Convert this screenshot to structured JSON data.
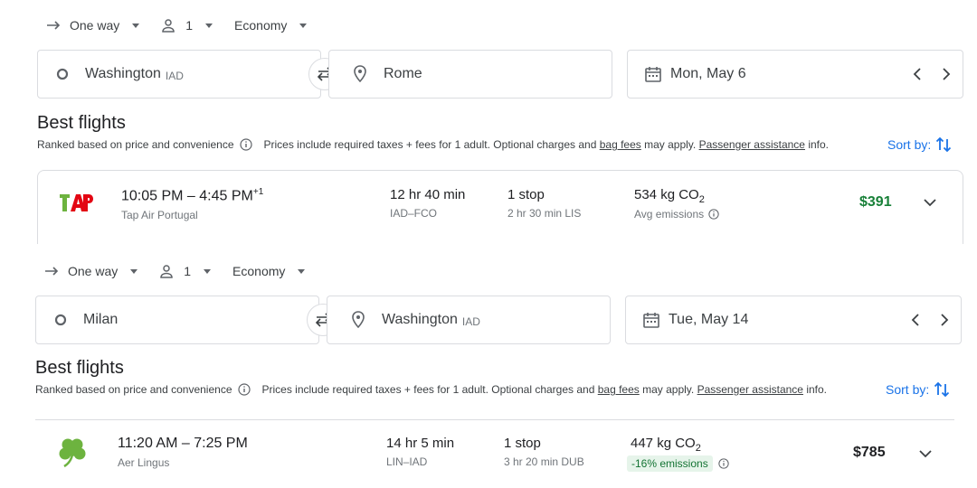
{
  "searches": [
    {
      "trip_type": "One way",
      "passengers": "1",
      "cabin": "Economy",
      "origin": {
        "city": "Washington",
        "code": "IAD"
      },
      "destination": {
        "city": "Rome",
        "code": ""
      },
      "date": "Mon, May 6",
      "section_title": "Best flights",
      "ranked_text": "Ranked based on price and convenience",
      "prices_text": "Prices include required taxes + fees for 1 adult. Optional charges and ",
      "bag_fees": "bag fees",
      "may_apply": " may apply. ",
      "passenger_assistance": "Passenger assistance",
      "info": " info.",
      "sort_by": "Sort by:",
      "flight": {
        "departure": "10:05 PM",
        "arrival": "4:45 PM",
        "day_offset": "+1",
        "airline": "Tap Air Portugal",
        "duration": "12 hr 40 min",
        "route": "IAD–FCO",
        "stops": "1 stop",
        "layover": "2 hr 30 min LIS",
        "emissions": "534 kg CO",
        "emissions_sub": "2",
        "emissions_label": "Avg emissions",
        "price": "$391",
        "price_color": "#188038"
      }
    },
    {
      "trip_type": "One way",
      "passengers": "1",
      "cabin": "Economy",
      "origin": {
        "city": "Milan",
        "code": ""
      },
      "destination": {
        "city": "Washington",
        "code": "IAD"
      },
      "date": "Tue, May 14",
      "section_title": "Best flights",
      "ranked_text": "Ranked based on price and convenience",
      "prices_text": "Prices include required taxes + fees for 1 adult. Optional charges and ",
      "bag_fees": "bag fees",
      "may_apply": " may apply. ",
      "passenger_assistance": "Passenger assistance",
      "info": " info.",
      "sort_by": "Sort by:",
      "flight": {
        "departure": "11:20 AM",
        "arrival": "7:25 PM",
        "day_offset": "",
        "airline": "Aer Lingus",
        "duration": "14 hr 5 min",
        "route": "LIN–IAD",
        "stops": "1 stop",
        "layover": "3 hr 20 min DUB",
        "emissions": "447 kg CO",
        "emissions_sub": "2",
        "emissions_label": "-16% emissions",
        "price": "$785",
        "price_color": "#202124"
      }
    }
  ],
  "colors": {
    "accent": "#1a73e8",
    "green": "#188038",
    "tap_green": "#6db33f",
    "tap_red": "#e30613"
  },
  "icons": [
    "arrow-right-icon",
    "person-icon",
    "circle-origin-icon",
    "swap-icon",
    "location-pin-icon",
    "calendar-icon",
    "chevron-left-icon",
    "chevron-right-icon",
    "info-icon",
    "sort-icon",
    "chevron-down-icon",
    "tap-logo",
    "aer-lingus-shamrock-logo"
  ]
}
